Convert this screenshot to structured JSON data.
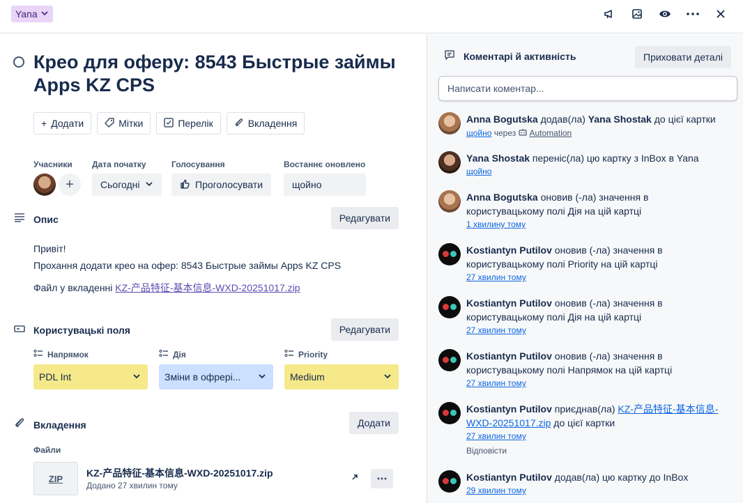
{
  "topbar": {
    "list_name": "Yana",
    "icons": [
      "megaphone-icon",
      "image-icon",
      "eye-icon",
      "more-icon",
      "close-icon"
    ]
  },
  "card": {
    "title": "Крео для оферу: 8543 Быстрые займы Apps KZ CPS",
    "actions": {
      "add": "Додати",
      "labels": "Мітки",
      "checklist": "Перелік",
      "attachment": "Вкладення"
    },
    "meta": {
      "members_label": "Учасники",
      "start_label": "Дата початку",
      "start_value": "Сьогодні",
      "votes_label": "Голосування",
      "vote_button": "Проголосувати",
      "updated_label": "Востаннє оновлено",
      "updated_value": "щойно"
    },
    "description": {
      "heading": "Опис",
      "edit": "Редагувати",
      "line1": "Привіт!",
      "line2": "Прохання додати крео на офер: 8543 Быстрые займы Apps KZ CPS",
      "line3_prefix": "Файл у вкладенні ",
      "line3_link": "KZ-产品特征-基本信息-WXD-20251017.zip"
    },
    "custom_fields": {
      "heading": "Користувацькі поля",
      "edit": "Редагувати",
      "fields": [
        {
          "label": "Напрямок",
          "value": "PDL Int",
          "color": "#f5e989"
        },
        {
          "label": "Дія",
          "value": "Зміни в офрері...",
          "color": "#cce0ff"
        },
        {
          "label": "Priority",
          "value": "Medium",
          "color": "#f5e989"
        }
      ]
    },
    "attachments": {
      "heading": "Вкладення",
      "add": "Додати",
      "files_label": "Файли",
      "file_thumb": "ZIP",
      "file_name": "KZ-产品特征-基本信息-WXD-20251017.zip",
      "file_added": "Додано 27 хвилин тому"
    }
  },
  "activity": {
    "heading": "Коментарі й активність",
    "hide_details": "Приховати деталі",
    "comment_placeholder": "Написати коментар...",
    "items": [
      {
        "who": "Anna Bogutska",
        "text": " додав(ла) ",
        "target": "Yana Shostak",
        "text2": " до цієї картки",
        "when": "щойно",
        "via": " через ",
        "auto": "Automation"
      },
      {
        "who": "Yana Shostak",
        "text": " переніс(ла) цю картку з InBox в Yana",
        "when": "щойно"
      },
      {
        "who": "Anna Bogutska",
        "text": " оновив (-ла) значення в користувацькому полі Дія на цій картці",
        "when": "1 хвилину тому"
      },
      {
        "who": "Kostiantyn Putilov",
        "text": " оновив (-ла) значення в користувацькому полі Priority на цій картці",
        "when": "27 хвилин тому"
      },
      {
        "who": "Kostiantyn Putilov",
        "text": " оновив (-ла) значення в користувацькому полі Дія на цій картці",
        "when": "27 хвилин тому"
      },
      {
        "who": "Kostiantyn Putilov",
        "text": " оновив (-ла) значення в користувацькому полі Напрямок на цій картці",
        "when": "27 хвилин тому"
      },
      {
        "who": "Kostiantyn Putilov",
        "text": " приєднав(ла) ",
        "link": "KZ-产品特征-基本信息-WXD-20251017.zip",
        "text2": " до цієї картки",
        "when": "27 хвилин тому",
        "reply": "Відповісти"
      },
      {
        "who": "Kostiantyn Putilov",
        "text": " додав(ла) цю картку до InBox",
        "when": "29 хвилин тому"
      }
    ]
  }
}
